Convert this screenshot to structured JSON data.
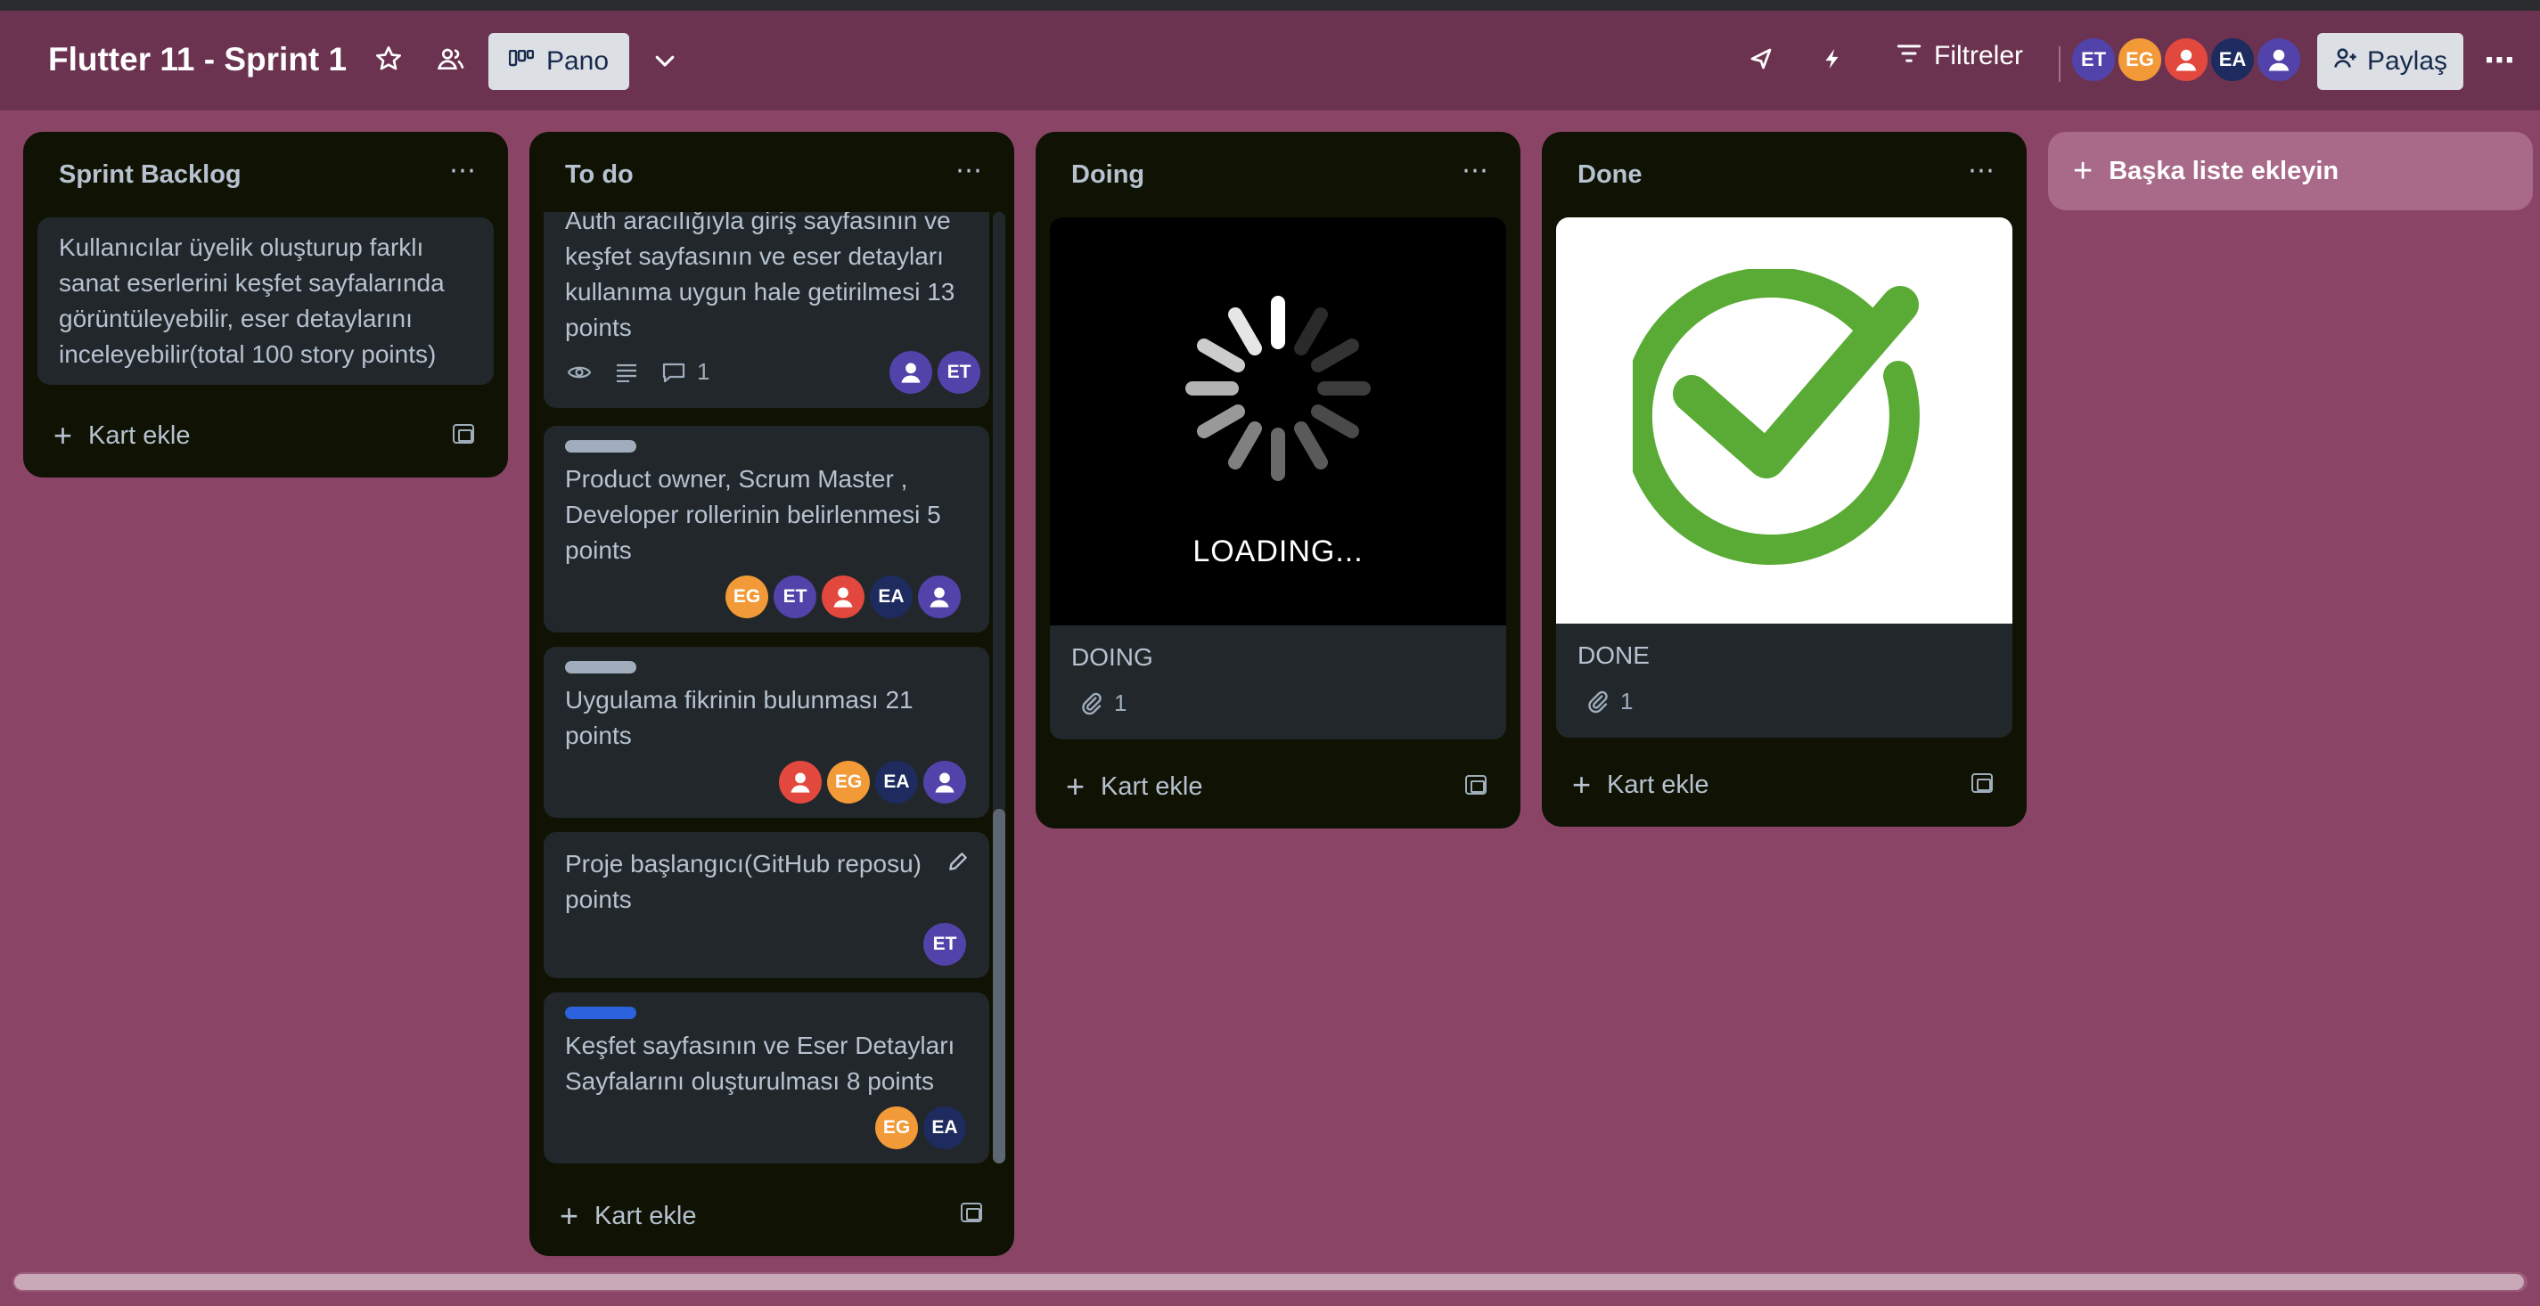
{
  "header": {
    "board_title": "Flutter 11 - Sprint 1",
    "view_label": "Pano",
    "filter_label": "Filtreler",
    "share_label": "Paylaş",
    "members": [
      {
        "initials": "ET",
        "color": "#5243aa"
      },
      {
        "initials": "EG",
        "color": "#f29a38"
      },
      {
        "initials": "",
        "color": "#e2483d",
        "icon": "person-icon"
      },
      {
        "initials": "EA",
        "color": "#1d2b5e"
      },
      {
        "initials": "",
        "color": "#5243aa",
        "icon": "person-icon"
      }
    ]
  },
  "lists": [
    {
      "title": "Sprint Backlog",
      "add_card": "Kart ekle",
      "cards": [
        {
          "text": "Kullanıcılar üyelik oluşturup farklı sanat eserlerini keşfet sayfalarında görüntüleyebilir, eser detaylarını inceleyebilir(total 100 story points)"
        }
      ]
    },
    {
      "title": "To do",
      "add_card": "Kart ekle",
      "cards": [
        {
          "text": "Auth aracılığıyla giriş sayfasının ve keşfet sayfasının ve eser detayları kullanıma uygun hale getirilmesi 13 points",
          "comments": "1",
          "members": [
            "",
            "ET"
          ]
        },
        {
          "text": "Product owner, Scrum Master , Developer rollerinin belirlenmesi 5 points",
          "label_color": "#9fadbc",
          "members": [
            "EG",
            "ET",
            "",
            "EA",
            ""
          ]
        },
        {
          "text": "Uygulama fikrinin bulunması 21 points",
          "label_color": "#9fadbc",
          "members": [
            "",
            "EG",
            "EA",
            ""
          ]
        },
        {
          "text": "Proje başlangıcı(GitHub reposu) points",
          "members": [
            "ET"
          ]
        },
        {
          "text": "Keşfet sayfasının ve Eser Detayları Sayfalarını oluşturulması 8 points",
          "label_color": "#2c62de",
          "members": [
            "EG",
            "EA"
          ]
        }
      ]
    },
    {
      "title": "Doing",
      "add_card": "Kart ekle",
      "cards": [
        {
          "text": "DOING",
          "cover_text": "LOADING...",
          "attachments": "1"
        }
      ]
    },
    {
      "title": "Done",
      "add_card": "Kart ekle",
      "cards": [
        {
          "text": "DONE",
          "attachments": "1"
        }
      ]
    }
  ],
  "add_list_label": "Başka liste ekleyin"
}
